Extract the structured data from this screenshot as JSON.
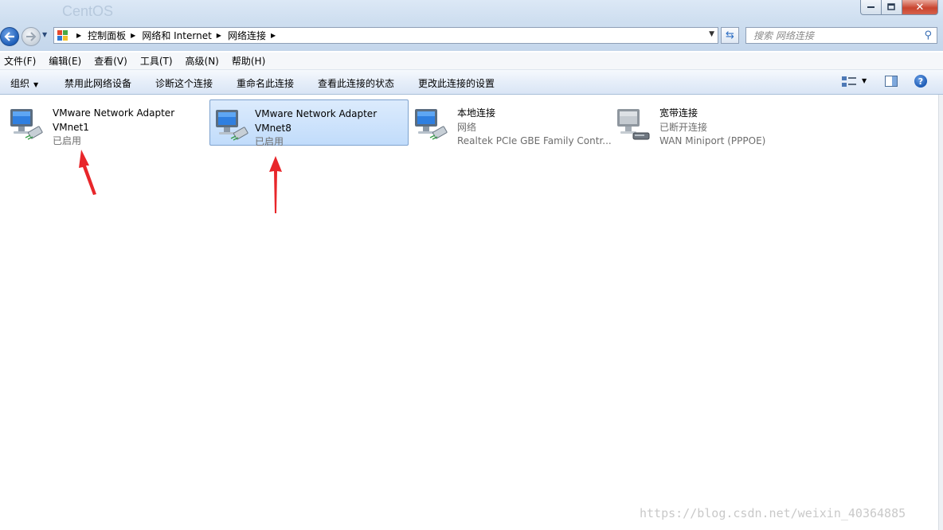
{
  "window": {
    "background_title": "CentOS"
  },
  "breadcrumbs": [
    "控制面板",
    "网络和 Internet",
    "网络连接"
  ],
  "search": {
    "placeholder": "搜索 网络连接"
  },
  "menu": [
    "文件(F)",
    "编辑(E)",
    "查看(V)",
    "工具(T)",
    "高级(N)",
    "帮助(H)"
  ],
  "commands": {
    "organize": "组织",
    "disable": "禁用此网络设备",
    "diagnose": "诊断这个连接",
    "rename": "重命名此连接",
    "status": "查看此连接的状态",
    "settings": "更改此连接的设置"
  },
  "adapters": [
    {
      "name": "VMware Network Adapter",
      "line2": "VMnet1",
      "line3": "已启用",
      "icon": "network-adapter-icon",
      "selected": false
    },
    {
      "name": "VMware Network Adapter",
      "line2": "VMnet8",
      "line3": "已启用",
      "icon": "network-adapter-icon",
      "selected": true
    },
    {
      "name": "本地连接",
      "line2": "网络",
      "line3": "Realtek PCIe GBE Family Contr...",
      "icon": "network-adapter-icon",
      "selected": false
    },
    {
      "name": "宽带连接",
      "line2": "已断开连接",
      "line3": "WAN Miniport (PPPOE)",
      "icon": "broadband-connection-icon",
      "selected": false
    }
  ],
  "watermark": "https://blog.csdn.net/weixin_40364885",
  "colors": {
    "selection_fill": "#c9e0fb",
    "selection_border": "#7da2ce",
    "annotation_arrow": "#e8262a",
    "secondary_text": "#6d6d6d"
  }
}
